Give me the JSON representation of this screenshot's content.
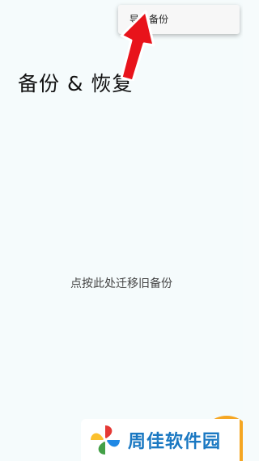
{
  "header": {
    "title": "备份 & 恢复"
  },
  "overflow_menu": {
    "items": [
      {
        "label": "导入备份"
      }
    ]
  },
  "main": {
    "empty_hint": "点按此处迁移旧备份"
  },
  "watermark": {
    "text": "周佳软件园"
  },
  "colors": {
    "background": "#f5fbfc",
    "arrow": "#e8131b",
    "fab": "#f5a623",
    "watermark_text": "#1a78c2"
  }
}
